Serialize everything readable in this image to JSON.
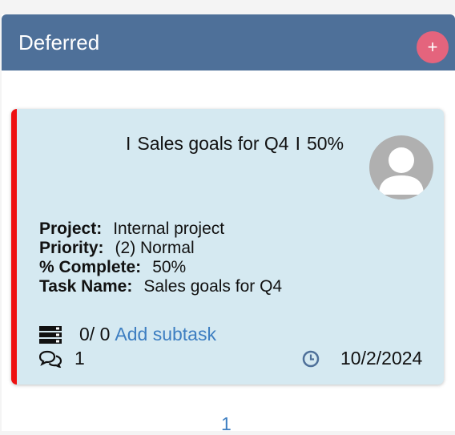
{
  "column": {
    "title": "Deferred",
    "add_label": "+"
  },
  "card": {
    "accent_color": "#ee1111",
    "title": "Sales goals for Q4",
    "title_separator": "I",
    "percent": "50%",
    "fields": [
      {
        "label": "Project:",
        "value": "Internal project"
      },
      {
        "label": "Priority:",
        "value": "(2) Normal"
      },
      {
        "label": "% Complete:",
        "value": "50%"
      },
      {
        "label": "Task Name:",
        "value": "Sales goals for Q4"
      }
    ],
    "subtasks": {
      "icon": "subtask-list-icon",
      "count": "0/ 0",
      "add_label": "Add subtask"
    },
    "comments": {
      "icon": "comments-icon",
      "count": "1"
    },
    "due": {
      "icon": "clock-icon",
      "date": "10/2/2024"
    }
  },
  "pager": {
    "current_page": "1"
  }
}
